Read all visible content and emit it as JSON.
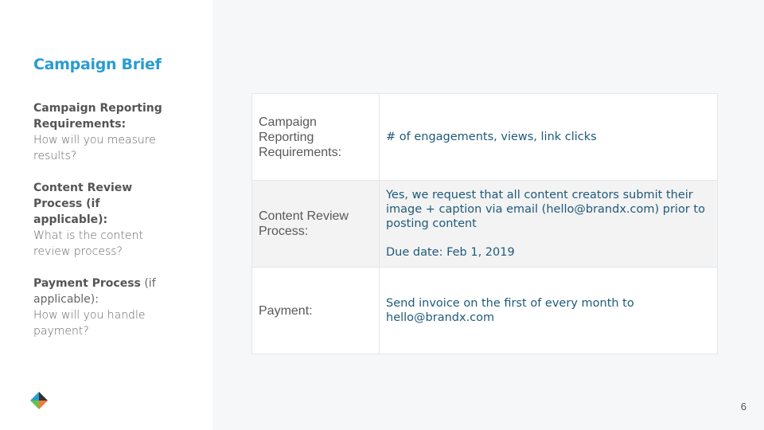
{
  "slide": {
    "title": "Campaign Brief",
    "page_number": "6"
  },
  "sidebar": {
    "blocks": [
      {
        "head": "Campaign Reporting Requirements:",
        "head_tail": "",
        "sub": "How will you measure results?"
      },
      {
        "head": "Content Review Process (if applicable):",
        "head_tail": "",
        "sub": "What is the content review process?"
      },
      {
        "head": "Payment Process",
        "head_tail": " (if applicable):",
        "sub": "How will you handle payment?"
      }
    ]
  },
  "table": {
    "rows": [
      {
        "label": "Campaign Reporting Requirements:",
        "value_lines": [
          "# of engagements, views, link clicks"
        ]
      },
      {
        "label": "Content Review Process:",
        "value_lines": [
          "Yes, we request that all content creators submit their image + caption via email (hello@brandx.com) prior to posting content",
          "Due date: Feb 1, 2019"
        ]
      },
      {
        "label": "Payment:",
        "value_lines": [
          "Send invoice on the first of every month to hello@brandx.com"
        ]
      }
    ]
  },
  "colors": {
    "accent": "#2a9bd1",
    "value_text": "#1e5a7a",
    "logo_dark": "#333333",
    "logo_blue": "#2a9bd1",
    "logo_orange": "#f07c3a",
    "logo_green": "#6cc04a"
  },
  "icons": {
    "logo": "brand-logo-icon"
  }
}
